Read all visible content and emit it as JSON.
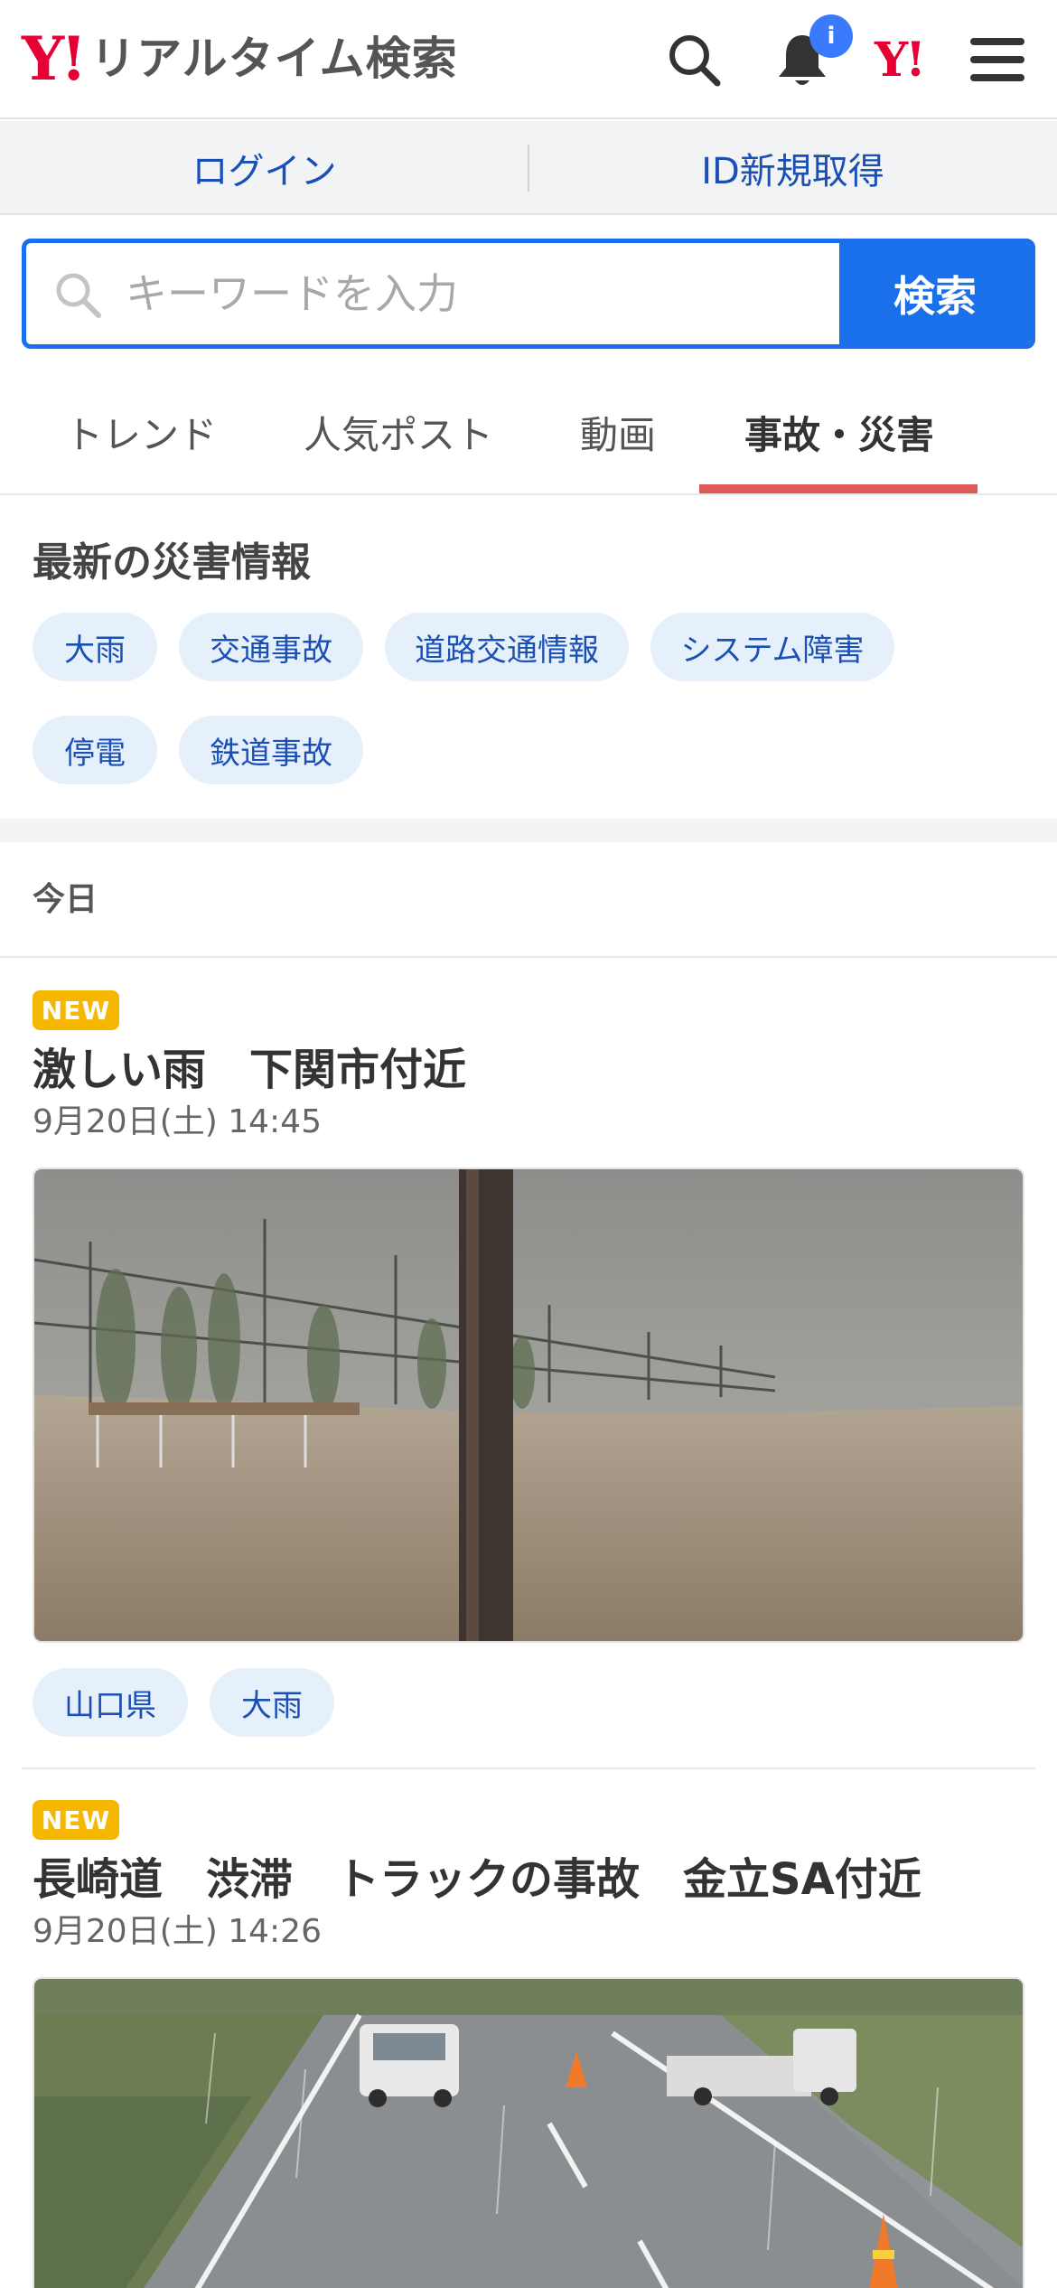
{
  "header": {
    "logo_y": "Y!",
    "logo_text": "リアルタイム検索",
    "notification_badge": "i",
    "yahoo_mark": "Y!"
  },
  "login_bar": {
    "login_label": "ログイン",
    "register_label": "ID新規取得"
  },
  "search": {
    "placeholder": "キーワードを入力",
    "button_label": "検索"
  },
  "tabs": [
    {
      "label": "トレンド"
    },
    {
      "label": "人気ポスト"
    },
    {
      "label": "動画"
    },
    {
      "label": "事故・災害",
      "active": true
    }
  ],
  "disaster_info": {
    "title": "最新の災害情報",
    "chips": [
      "大雨",
      "交通事故",
      "道路交通情報",
      "システム障害",
      "停電",
      "鉄道事故"
    ]
  },
  "today_label": "今日",
  "articles": [
    {
      "badge": "NEW",
      "title": "激しい雨　下関市付近",
      "date": "9月20日(土) 14:45",
      "tags": [
        "山口県",
        "大雨"
      ]
    },
    {
      "badge": "NEW",
      "title": "長崎道　渋滞　トラックの事故　金立SA付近",
      "date": "9月20日(土) 14:26",
      "tags": []
    }
  ],
  "colors": {
    "brand_red": "#e60033",
    "accent_blue": "#1a70ea",
    "chip_bg": "#e6f0fb",
    "chip_text": "#1a4fb6",
    "new_badge": "#f5b700",
    "tab_underline": "#e05a5a"
  },
  "icons": [
    "search-icon",
    "bell-icon",
    "menu-icon",
    "search-field-icon"
  ]
}
